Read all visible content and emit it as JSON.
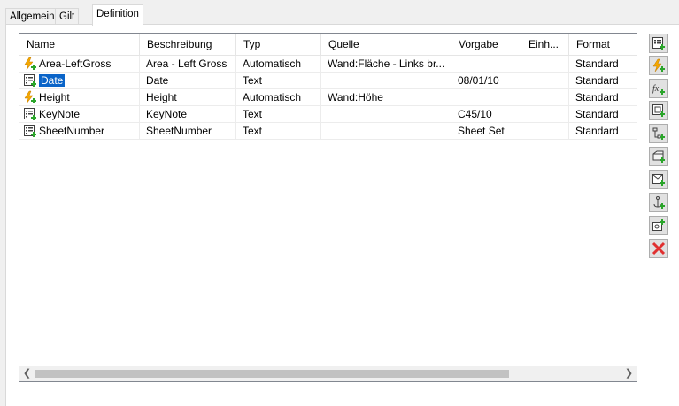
{
  "tabs": [
    {
      "label": "Allgemein"
    },
    {
      "label": "Gilt für"
    },
    {
      "label": "Definition"
    }
  ],
  "table": {
    "columns": [
      "Name",
      "Beschreibung",
      "Typ",
      "Quelle",
      "Vorgabe",
      "Einh...",
      "Format"
    ],
    "rows": [
      {
        "icon": "automatic-property-icon",
        "name": "Area-LeftGross",
        "beschreibung": "Area - Left Gross",
        "typ": "Automatisch",
        "quelle": "Wand:Fläche - Links br...",
        "vorgabe": "",
        "einheit": "",
        "format": "Standard"
      },
      {
        "icon": "manual-property-icon",
        "name": "Date",
        "beschreibung": "Date",
        "typ": "Text",
        "quelle": "",
        "vorgabe": "08/01/10",
        "einheit": "",
        "format": "Standard",
        "selected": true
      },
      {
        "icon": "automatic-property-icon",
        "name": "Height",
        "beschreibung": "Height",
        "typ": "Automatisch",
        "quelle": "Wand:Höhe",
        "vorgabe": "",
        "einheit": "",
        "format": "Standard"
      },
      {
        "icon": "manual-property-icon",
        "name": "KeyNote",
        "beschreibung": "KeyNote",
        "typ": "Text",
        "quelle": "",
        "vorgabe": "C45/10",
        "einheit": "",
        "format": "Standard"
      },
      {
        "icon": "manual-property-icon",
        "name": "SheetNumber",
        "beschreibung": "SheetNumber",
        "typ": "Text",
        "quelle": "",
        "vorgabe": "Sheet Set",
        "einheit": "",
        "format": "Standard"
      }
    ]
  },
  "toolbar": [
    {
      "icon": "add-manual-property-icon"
    },
    {
      "icon": "add-automatic-property-icon"
    },
    {
      "icon": "add-formula-property-icon"
    },
    {
      "icon": "add-location-property-icon"
    },
    {
      "icon": "add-classification-property-icon"
    },
    {
      "icon": "add-material-property-icon"
    },
    {
      "icon": "add-project-property-icon"
    },
    {
      "icon": "add-anchor-property-icon"
    },
    {
      "icon": "add-graphic-property-icon"
    },
    {
      "icon": "delete-icon"
    }
  ],
  "colors": {
    "selection": "#0a64c8",
    "lightning": "#f5a800",
    "plus": "#2aa52a",
    "delete": "#e03030"
  }
}
